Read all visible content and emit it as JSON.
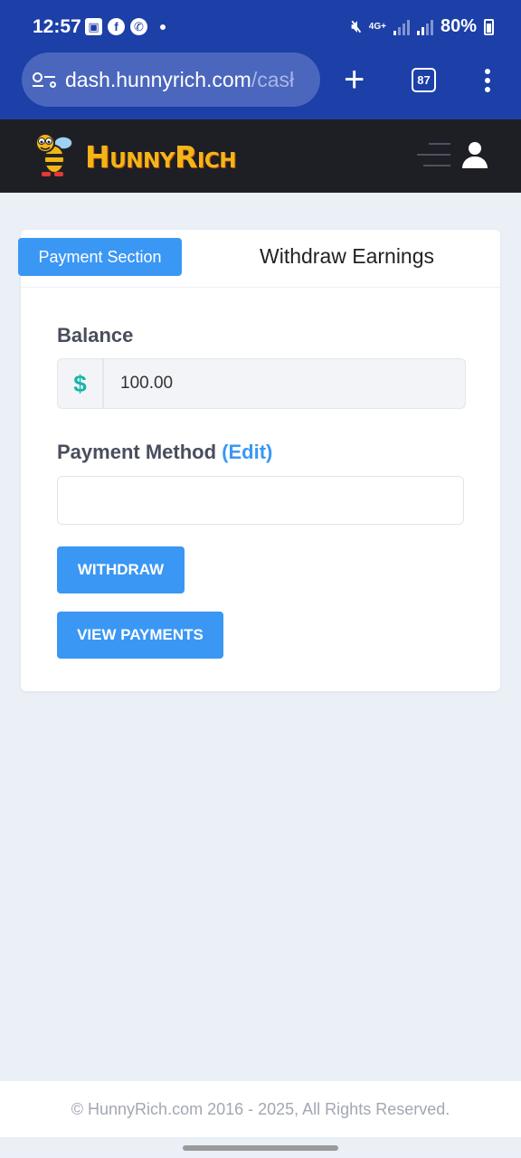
{
  "status_bar": {
    "time": "12:57",
    "network": "4G+",
    "battery": "80%"
  },
  "browser": {
    "url_host": "dash.hunnyrich.com",
    "url_path": "/casł",
    "tab_count": "87"
  },
  "site": {
    "brand": "HunnyRich"
  },
  "card": {
    "section_label": "Payment Section",
    "title": "Withdraw Earnings",
    "balance_label": "Balance",
    "currency_symbol": "$",
    "balance_value": "100.00",
    "payment_method_label": "Payment Method",
    "edit_label": "(Edit)",
    "payment_method_value": "",
    "withdraw_button": "WITHDRAW",
    "view_payments_button": "VIEW PAYMENTS"
  },
  "footer": {
    "copyright": "© HunnyRich.com 2016 - 2025, All Rights Reserved."
  },
  "colors": {
    "browser_bar": "#1c3fa8",
    "site_header": "#1e1e25",
    "brand": "#f3b616",
    "accent": "#3a97f4",
    "currency": "#17b5a8",
    "page_bg": "#ebeff6"
  }
}
